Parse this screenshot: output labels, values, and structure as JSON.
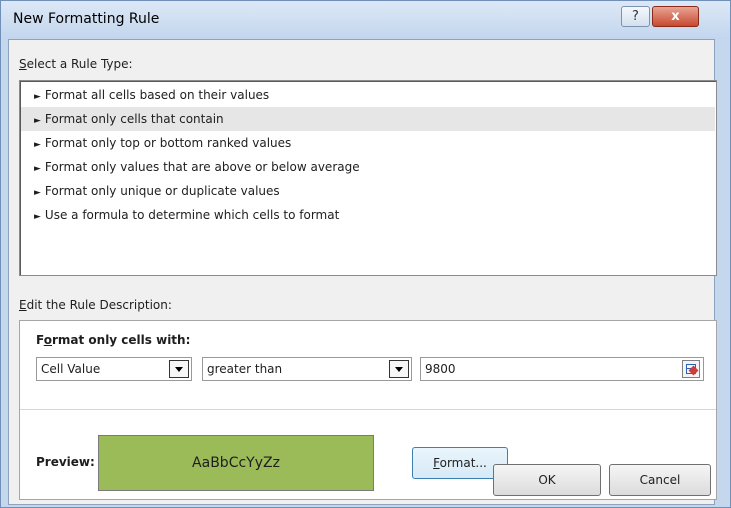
{
  "window": {
    "title": "New Formatting Rule",
    "help_label": "?",
    "close_label": "x"
  },
  "rule_type": {
    "label_accel": "S",
    "label_rest": "elect a Rule Type:",
    "items": [
      "Format all cells based on their values",
      "Format only cells that contain",
      "Format only top or bottom ranked values",
      "Format only values that are above or below average",
      "Format only unique or duplicate values",
      "Use a formula to determine which cells to format"
    ],
    "selected_index": 1
  },
  "description": {
    "label_accel": "E",
    "label_rest": "dit the Rule Description:",
    "heading_pre": "F",
    "heading_accel": "o",
    "heading_rest": "rmat only cells with:",
    "condition_type": "Cell Value",
    "operator": "greater than",
    "value": "9800",
    "preview_label": "Preview:",
    "preview_text": "AaBbCcYyZz",
    "preview_color": "#9bbb59",
    "format_accel": "F",
    "format_rest": "ormat..."
  },
  "buttons": {
    "ok": "OK",
    "cancel": "Cancel"
  }
}
